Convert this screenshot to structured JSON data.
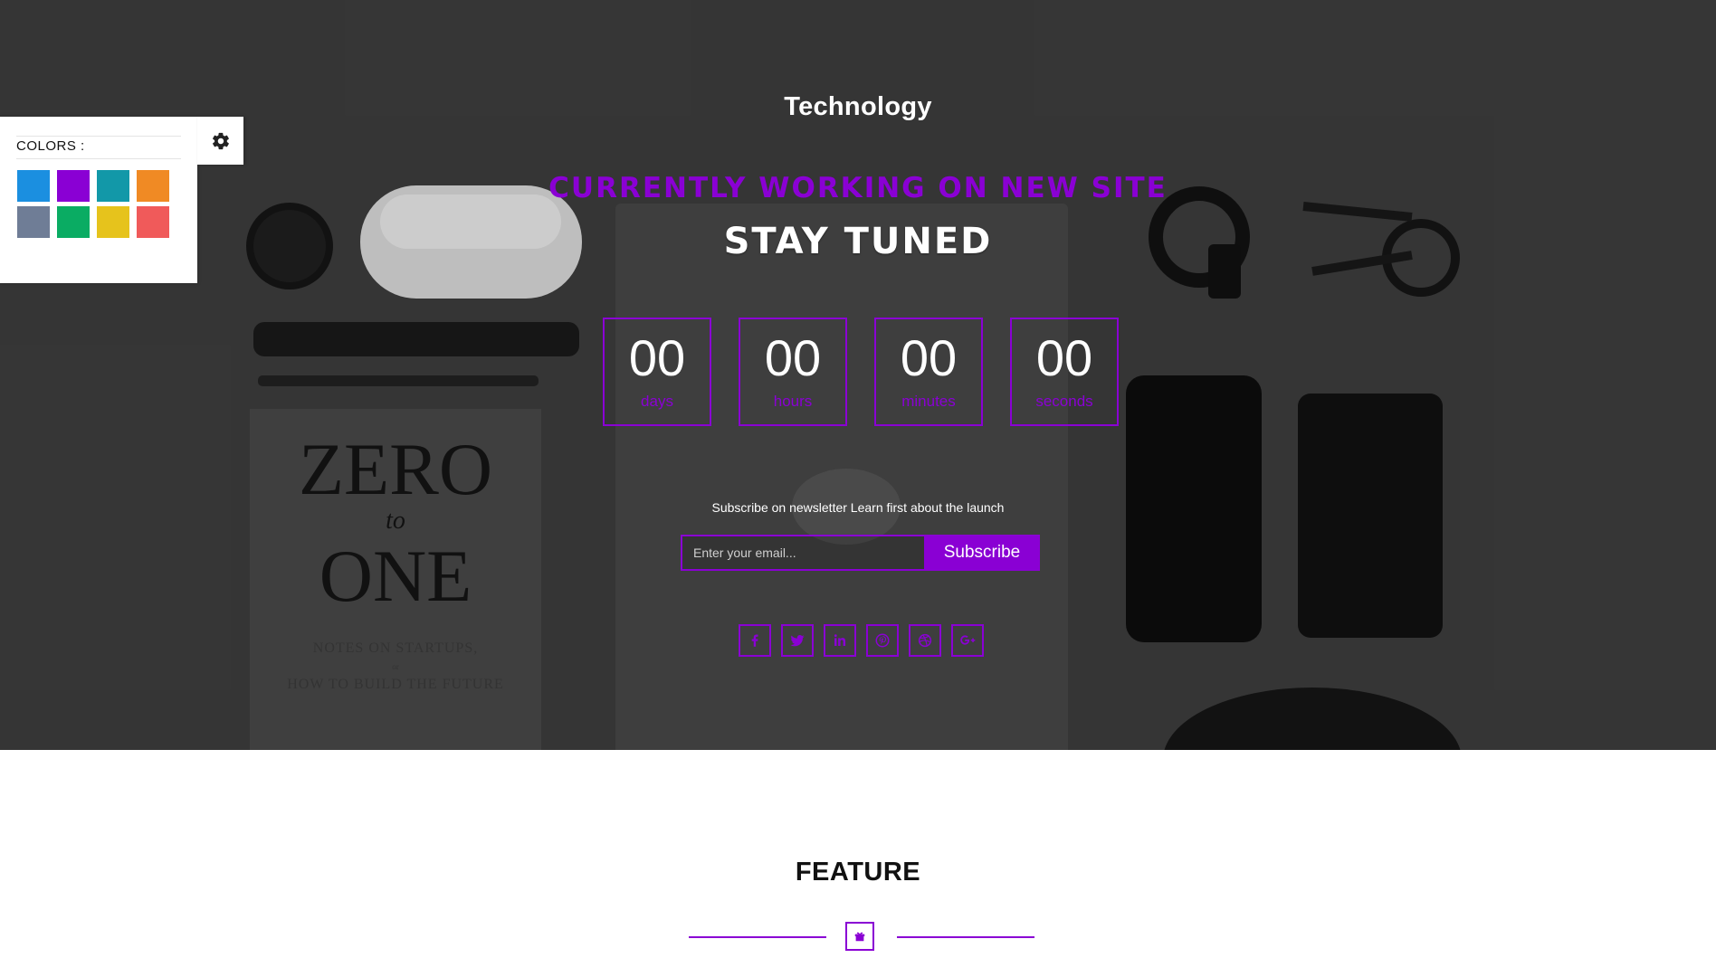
{
  "hero": {
    "brand": "Technology",
    "headline": "CURRENTLY WORKING ON NEW SITE",
    "subheadline": "STAY TUNED",
    "countdown": [
      {
        "value": "00",
        "label": "days"
      },
      {
        "value": "00",
        "label": "hours"
      },
      {
        "value": "00",
        "label": "minutes"
      },
      {
        "value": "00",
        "label": "seconds"
      }
    ],
    "newsletter_text": "Subscribe on newsletter Learn first about the launch",
    "email_placeholder": "Enter your email...",
    "subscribe_label": "Subscribe",
    "social": [
      "facebook-icon",
      "twitter-icon",
      "linkedin-icon",
      "pinterest-icon",
      "dribbble-icon",
      "google-plus-icon"
    ],
    "background_book": {
      "title_line1": "ZERO",
      "title_line2": "to",
      "title_line3": "ONE",
      "subtitle": "NOTES ON STARTUPS,",
      "subtitle2": "or",
      "subtitle3": "HOW TO BUILD THE FUTURE"
    }
  },
  "switcher": {
    "title": "COLORS :",
    "colors": [
      "#1b8fe0",
      "#8a00d4",
      "#1298a8",
      "#f08a24",
      "#6f7d96",
      "#0aac63",
      "#e6c31c",
      "#f05a5a"
    ],
    "toggle_icon": "gear-icon"
  },
  "feature": {
    "title": "FEATURE",
    "icon": "gift-icon"
  },
  "colors": {
    "accent": "#8a00d4",
    "hero_bg": "#3b3b3b"
  }
}
